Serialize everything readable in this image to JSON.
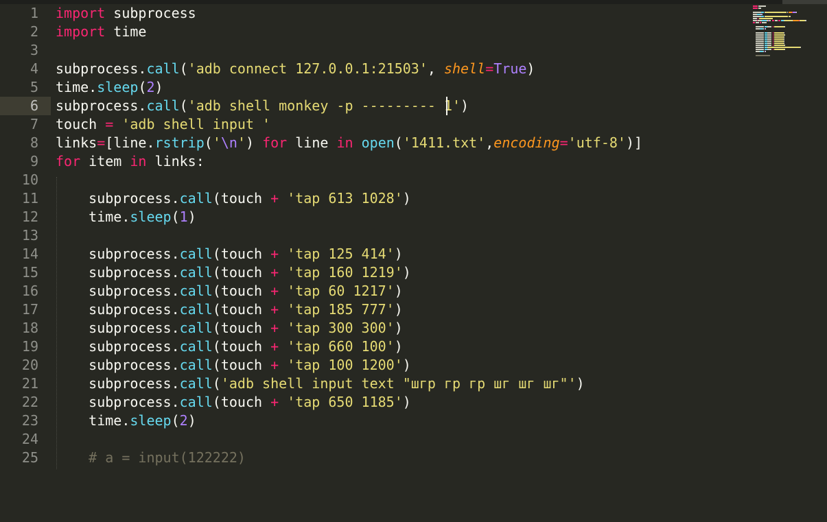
{
  "editor": {
    "current_line": 6,
    "lines": [
      {
        "n": "1",
        "tokens": [
          {
            "t": "import",
            "c": "kw"
          },
          {
            "t": " subprocess",
            "c": ""
          }
        ]
      },
      {
        "n": "2",
        "tokens": [
          {
            "t": "import",
            "c": "kw"
          },
          {
            "t": " time",
            "c": ""
          }
        ]
      },
      {
        "n": "3",
        "tokens": []
      },
      {
        "n": "4",
        "tokens": [
          {
            "t": "subprocess.",
            "c": ""
          },
          {
            "t": "call",
            "c": "fn"
          },
          {
            "t": "(",
            "c": ""
          },
          {
            "t": "'adb connect 127.0.0.1:21503'",
            "c": "str"
          },
          {
            "t": ", ",
            "c": ""
          },
          {
            "t": "shell",
            "c": "param"
          },
          {
            "t": "=",
            "c": "kw"
          },
          {
            "t": "True",
            "c": "const"
          },
          {
            "t": ")",
            "c": ""
          }
        ]
      },
      {
        "n": "5",
        "tokens": [
          {
            "t": "time.",
            "c": ""
          },
          {
            "t": "sleep",
            "c": "fn"
          },
          {
            "t": "(",
            "c": ""
          },
          {
            "t": "2",
            "c": "num"
          },
          {
            "t": ")",
            "c": ""
          }
        ]
      },
      {
        "n": "6",
        "tokens": [
          {
            "t": "subprocess.",
            "c": ""
          },
          {
            "t": "call",
            "c": "fn"
          },
          {
            "t": "(",
            "c": ""
          },
          {
            "t": "'adb shell monkey -p ---------",
            "c": "str"
          },
          {
            "t": " 1'",
            "c": "str"
          },
          {
            "t": ")",
            "c": ""
          }
        ]
      },
      {
        "n": "7",
        "tokens": [
          {
            "t": "touch ",
            "c": ""
          },
          {
            "t": "=",
            "c": "kw"
          },
          {
            "t": " ",
            "c": ""
          },
          {
            "t": "'adb shell input '",
            "c": "str"
          }
        ]
      },
      {
        "n": "8",
        "tokens": [
          {
            "t": "links",
            "c": ""
          },
          {
            "t": "=",
            "c": "kw"
          },
          {
            "t": "[line.",
            "c": ""
          },
          {
            "t": "rstrip",
            "c": "fn"
          },
          {
            "t": "(",
            "c": ""
          },
          {
            "t": "'",
            "c": "str"
          },
          {
            "t": "\\n",
            "c": "const"
          },
          {
            "t": "'",
            "c": "str"
          },
          {
            "t": ") ",
            "c": ""
          },
          {
            "t": "for",
            "c": "kw"
          },
          {
            "t": " line ",
            "c": ""
          },
          {
            "t": "in",
            "c": "kw"
          },
          {
            "t": " ",
            "c": ""
          },
          {
            "t": "open",
            "c": "fn"
          },
          {
            "t": "(",
            "c": ""
          },
          {
            "t": "'1411.txt'",
            "c": "str"
          },
          {
            "t": ",",
            "c": ""
          },
          {
            "t": "encoding",
            "c": "param"
          },
          {
            "t": "=",
            "c": "kw"
          },
          {
            "t": "'utf-8'",
            "c": "str"
          },
          {
            "t": ")]",
            "c": ""
          }
        ]
      },
      {
        "n": "9",
        "tokens": [
          {
            "t": "for",
            "c": "kw"
          },
          {
            "t": " item ",
            "c": ""
          },
          {
            "t": "in",
            "c": "kw"
          },
          {
            "t": " links:",
            "c": ""
          }
        ]
      },
      {
        "n": "10",
        "tokens": []
      },
      {
        "n": "11",
        "tokens": [
          {
            "t": "    subprocess.",
            "c": ""
          },
          {
            "t": "call",
            "c": "fn"
          },
          {
            "t": "(touch ",
            "c": ""
          },
          {
            "t": "+",
            "c": "kw"
          },
          {
            "t": " ",
            "c": ""
          },
          {
            "t": "'tap 613 1028'",
            "c": "str"
          },
          {
            "t": ")",
            "c": ""
          }
        ]
      },
      {
        "n": "12",
        "tokens": [
          {
            "t": "    time.",
            "c": ""
          },
          {
            "t": "sleep",
            "c": "fn"
          },
          {
            "t": "(",
            "c": ""
          },
          {
            "t": "1",
            "c": "num"
          },
          {
            "t": ")",
            "c": ""
          }
        ]
      },
      {
        "n": "13",
        "tokens": []
      },
      {
        "n": "14",
        "tokens": [
          {
            "t": "    subprocess.",
            "c": ""
          },
          {
            "t": "call",
            "c": "fn"
          },
          {
            "t": "(touch ",
            "c": ""
          },
          {
            "t": "+",
            "c": "kw"
          },
          {
            "t": " ",
            "c": ""
          },
          {
            "t": "'tap 125 414'",
            "c": "str"
          },
          {
            "t": ")",
            "c": ""
          }
        ]
      },
      {
        "n": "15",
        "tokens": [
          {
            "t": "    subprocess.",
            "c": ""
          },
          {
            "t": "call",
            "c": "fn"
          },
          {
            "t": "(touch ",
            "c": ""
          },
          {
            "t": "+",
            "c": "kw"
          },
          {
            "t": " ",
            "c": ""
          },
          {
            "t": "'tap 160 1219'",
            "c": "str"
          },
          {
            "t": ")",
            "c": ""
          }
        ]
      },
      {
        "n": "16",
        "tokens": [
          {
            "t": "    subprocess.",
            "c": ""
          },
          {
            "t": "call",
            "c": "fn"
          },
          {
            "t": "(touch ",
            "c": ""
          },
          {
            "t": "+",
            "c": "kw"
          },
          {
            "t": " ",
            "c": ""
          },
          {
            "t": "'tap 60 1217'",
            "c": "str"
          },
          {
            "t": ")",
            "c": ""
          }
        ]
      },
      {
        "n": "17",
        "tokens": [
          {
            "t": "    subprocess.",
            "c": ""
          },
          {
            "t": "call",
            "c": "fn"
          },
          {
            "t": "(touch ",
            "c": ""
          },
          {
            "t": "+",
            "c": "kw"
          },
          {
            "t": " ",
            "c": ""
          },
          {
            "t": "'tap 185 777'",
            "c": "str"
          },
          {
            "t": ")",
            "c": ""
          }
        ]
      },
      {
        "n": "18",
        "tokens": [
          {
            "t": "    subprocess.",
            "c": ""
          },
          {
            "t": "call",
            "c": "fn"
          },
          {
            "t": "(touch ",
            "c": ""
          },
          {
            "t": "+",
            "c": "kw"
          },
          {
            "t": " ",
            "c": ""
          },
          {
            "t": "'tap 300 300'",
            "c": "str"
          },
          {
            "t": ")",
            "c": ""
          }
        ]
      },
      {
        "n": "19",
        "tokens": [
          {
            "t": "    subprocess.",
            "c": ""
          },
          {
            "t": "call",
            "c": "fn"
          },
          {
            "t": "(touch ",
            "c": ""
          },
          {
            "t": "+",
            "c": "kw"
          },
          {
            "t": " ",
            "c": ""
          },
          {
            "t": "'tap 660 100'",
            "c": "str"
          },
          {
            "t": ")",
            "c": ""
          }
        ]
      },
      {
        "n": "20",
        "tokens": [
          {
            "t": "    subprocess.",
            "c": ""
          },
          {
            "t": "call",
            "c": "fn"
          },
          {
            "t": "(touch ",
            "c": ""
          },
          {
            "t": "+",
            "c": "kw"
          },
          {
            "t": " ",
            "c": ""
          },
          {
            "t": "'tap 100 1200'",
            "c": "str"
          },
          {
            "t": ")",
            "c": ""
          }
        ]
      },
      {
        "n": "21",
        "tokens": [
          {
            "t": "    subprocess.",
            "c": ""
          },
          {
            "t": "call",
            "c": "fn"
          },
          {
            "t": "(",
            "c": ""
          },
          {
            "t": "'adb shell input text \"шгр гр гр шг шг шг\"'",
            "c": "str"
          },
          {
            "t": ")",
            "c": ""
          }
        ]
      },
      {
        "n": "22",
        "tokens": [
          {
            "t": "    subprocess.",
            "c": ""
          },
          {
            "t": "call",
            "c": "fn"
          },
          {
            "t": "(touch ",
            "c": ""
          },
          {
            "t": "+",
            "c": "kw"
          },
          {
            "t": " ",
            "c": ""
          },
          {
            "t": "'tap 650 1185'",
            "c": "str"
          },
          {
            "t": ")",
            "c": ""
          }
        ]
      },
      {
        "n": "23",
        "tokens": [
          {
            "t": "    time.",
            "c": ""
          },
          {
            "t": "sleep",
            "c": "fn"
          },
          {
            "t": "(",
            "c": ""
          },
          {
            "t": "2",
            "c": "num"
          },
          {
            "t": ")",
            "c": ""
          }
        ]
      },
      {
        "n": "24",
        "tokens": []
      },
      {
        "n": "25",
        "tokens": [
          {
            "t": "    # a = input(122222)",
            "c": "com"
          }
        ]
      }
    ]
  },
  "theme": {
    "background": "#272822",
    "keyword": "#f92672",
    "string": "#e6db74",
    "function": "#66d9ef",
    "number": "#ae81ff",
    "parameter": "#fd971f",
    "comment": "#75715e"
  }
}
